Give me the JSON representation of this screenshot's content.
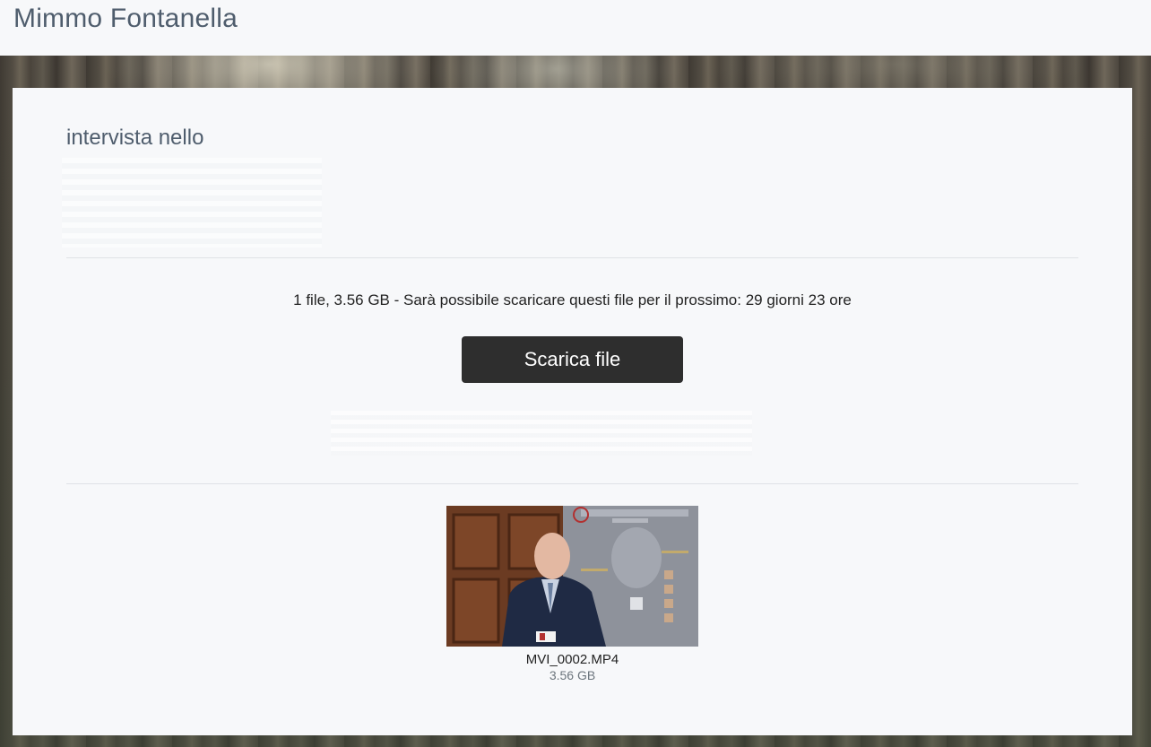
{
  "header": {
    "site_title": "Mimmo Fontanella"
  },
  "transfer": {
    "heading": "intervista nello",
    "info_line": "1 file, 3.56 GB - Sarà possibile scaricare questi file per il prossimo: 29 giorni 23 ore",
    "download_label": "Scarica file"
  },
  "files": [
    {
      "name": "MVI_0002.MP4",
      "size": "3.56 GB",
      "thumbnail_icon": "video-thumbnail"
    }
  ],
  "colors": {
    "button_bg": "#2e2e2e",
    "title_text": "#4f5d6d",
    "card_bg": "#f7f8fa"
  }
}
